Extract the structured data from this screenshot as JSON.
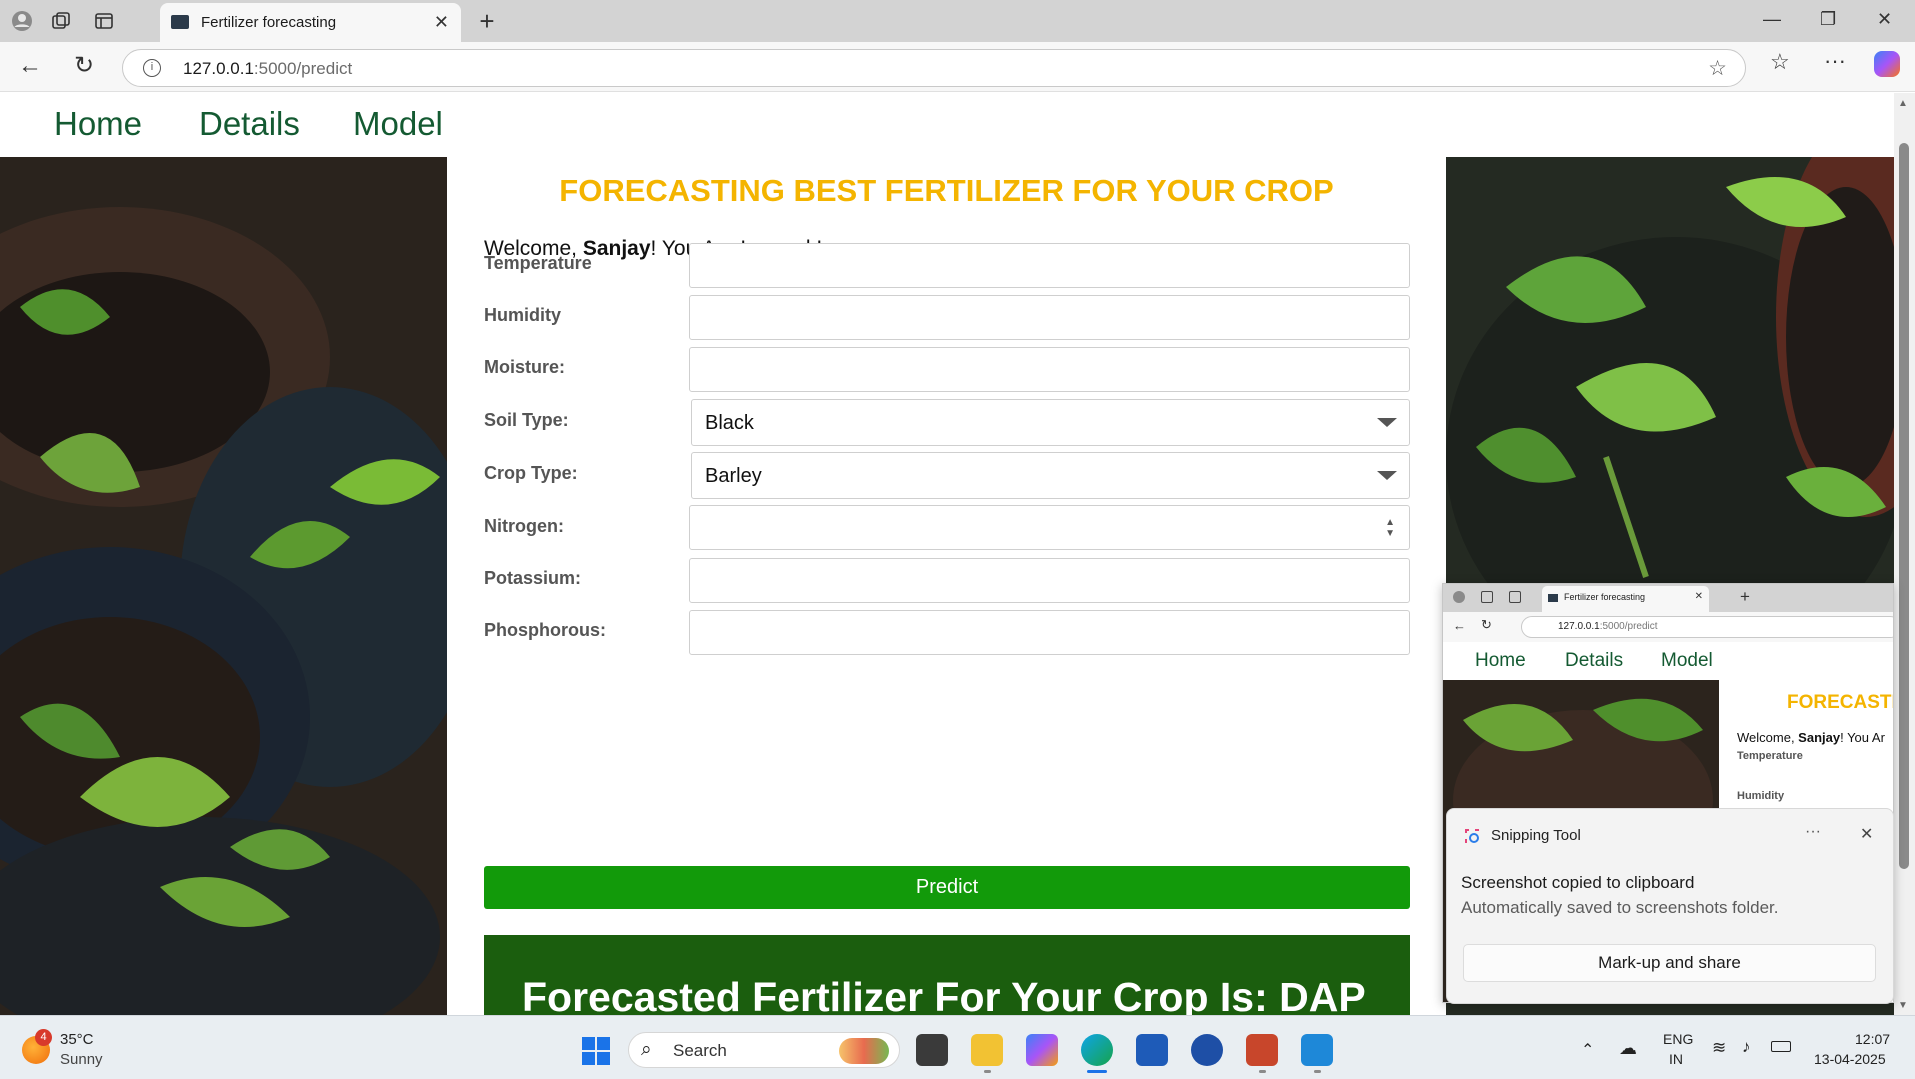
{
  "browser": {
    "tab_title": "Fertilizer forecasting",
    "url_host": "127.0.0.1",
    "url_rest": ":5000/predict",
    "new_tab": "+",
    "tab_close": "✕"
  },
  "nav": {
    "items": [
      "Home",
      "Details",
      "Model"
    ]
  },
  "page": {
    "heading": "FORECASTING BEST FERTILIZER FOR YOUR CROP",
    "welcome_prefix": "Welcome, ",
    "welcome_user": "Sanjay",
    "welcome_suffix": "! You Are Logged In.",
    "fields": {
      "temperature": "Temperature",
      "humidity": "Humidity",
      "moisture": "Moisture:",
      "soil_type": "Soil Type:",
      "crop_type": "Crop Type:",
      "nitrogen": "Nitrogen:",
      "potassium": "Potassium:",
      "phosphorous": "Phosphorous:"
    },
    "soil_value": "Black",
    "crop_value": "Barley",
    "predict_label": "Predict",
    "result_text": "Forecasted Fertilizer For Your Crop Is: DAP"
  },
  "preview": {
    "tab_title": "Fertilizer forecasting",
    "url": "127.0.0.1",
    "url_rest": ":5000/predict",
    "nav": [
      "Home",
      "Details",
      "Model"
    ],
    "heading": "FORECASTI",
    "welcome_prefix": "Welcome, ",
    "welcome_user": "Sanjay",
    "welcome_suffix": "! You Ar",
    "label1": "Temperature",
    "label2": "Humidity"
  },
  "toast": {
    "app": "Snipping Tool",
    "more": "···",
    "title": "Screenshot copied to clipboard",
    "subtitle": "Automatically saved to screenshots folder.",
    "button": "Mark-up and share"
  },
  "taskbar": {
    "weather_badge": "4",
    "temp": "35°C",
    "condition": "Sunny",
    "search": "Search",
    "lang1": "ENG",
    "lang2": "IN",
    "time": "12:07",
    "date": "13-04-2025"
  },
  "colors": {
    "heading": "#f4b400",
    "predict": "#129a0a",
    "result_bg": "#1b5e0e",
    "nav_link": "#145a32"
  }
}
